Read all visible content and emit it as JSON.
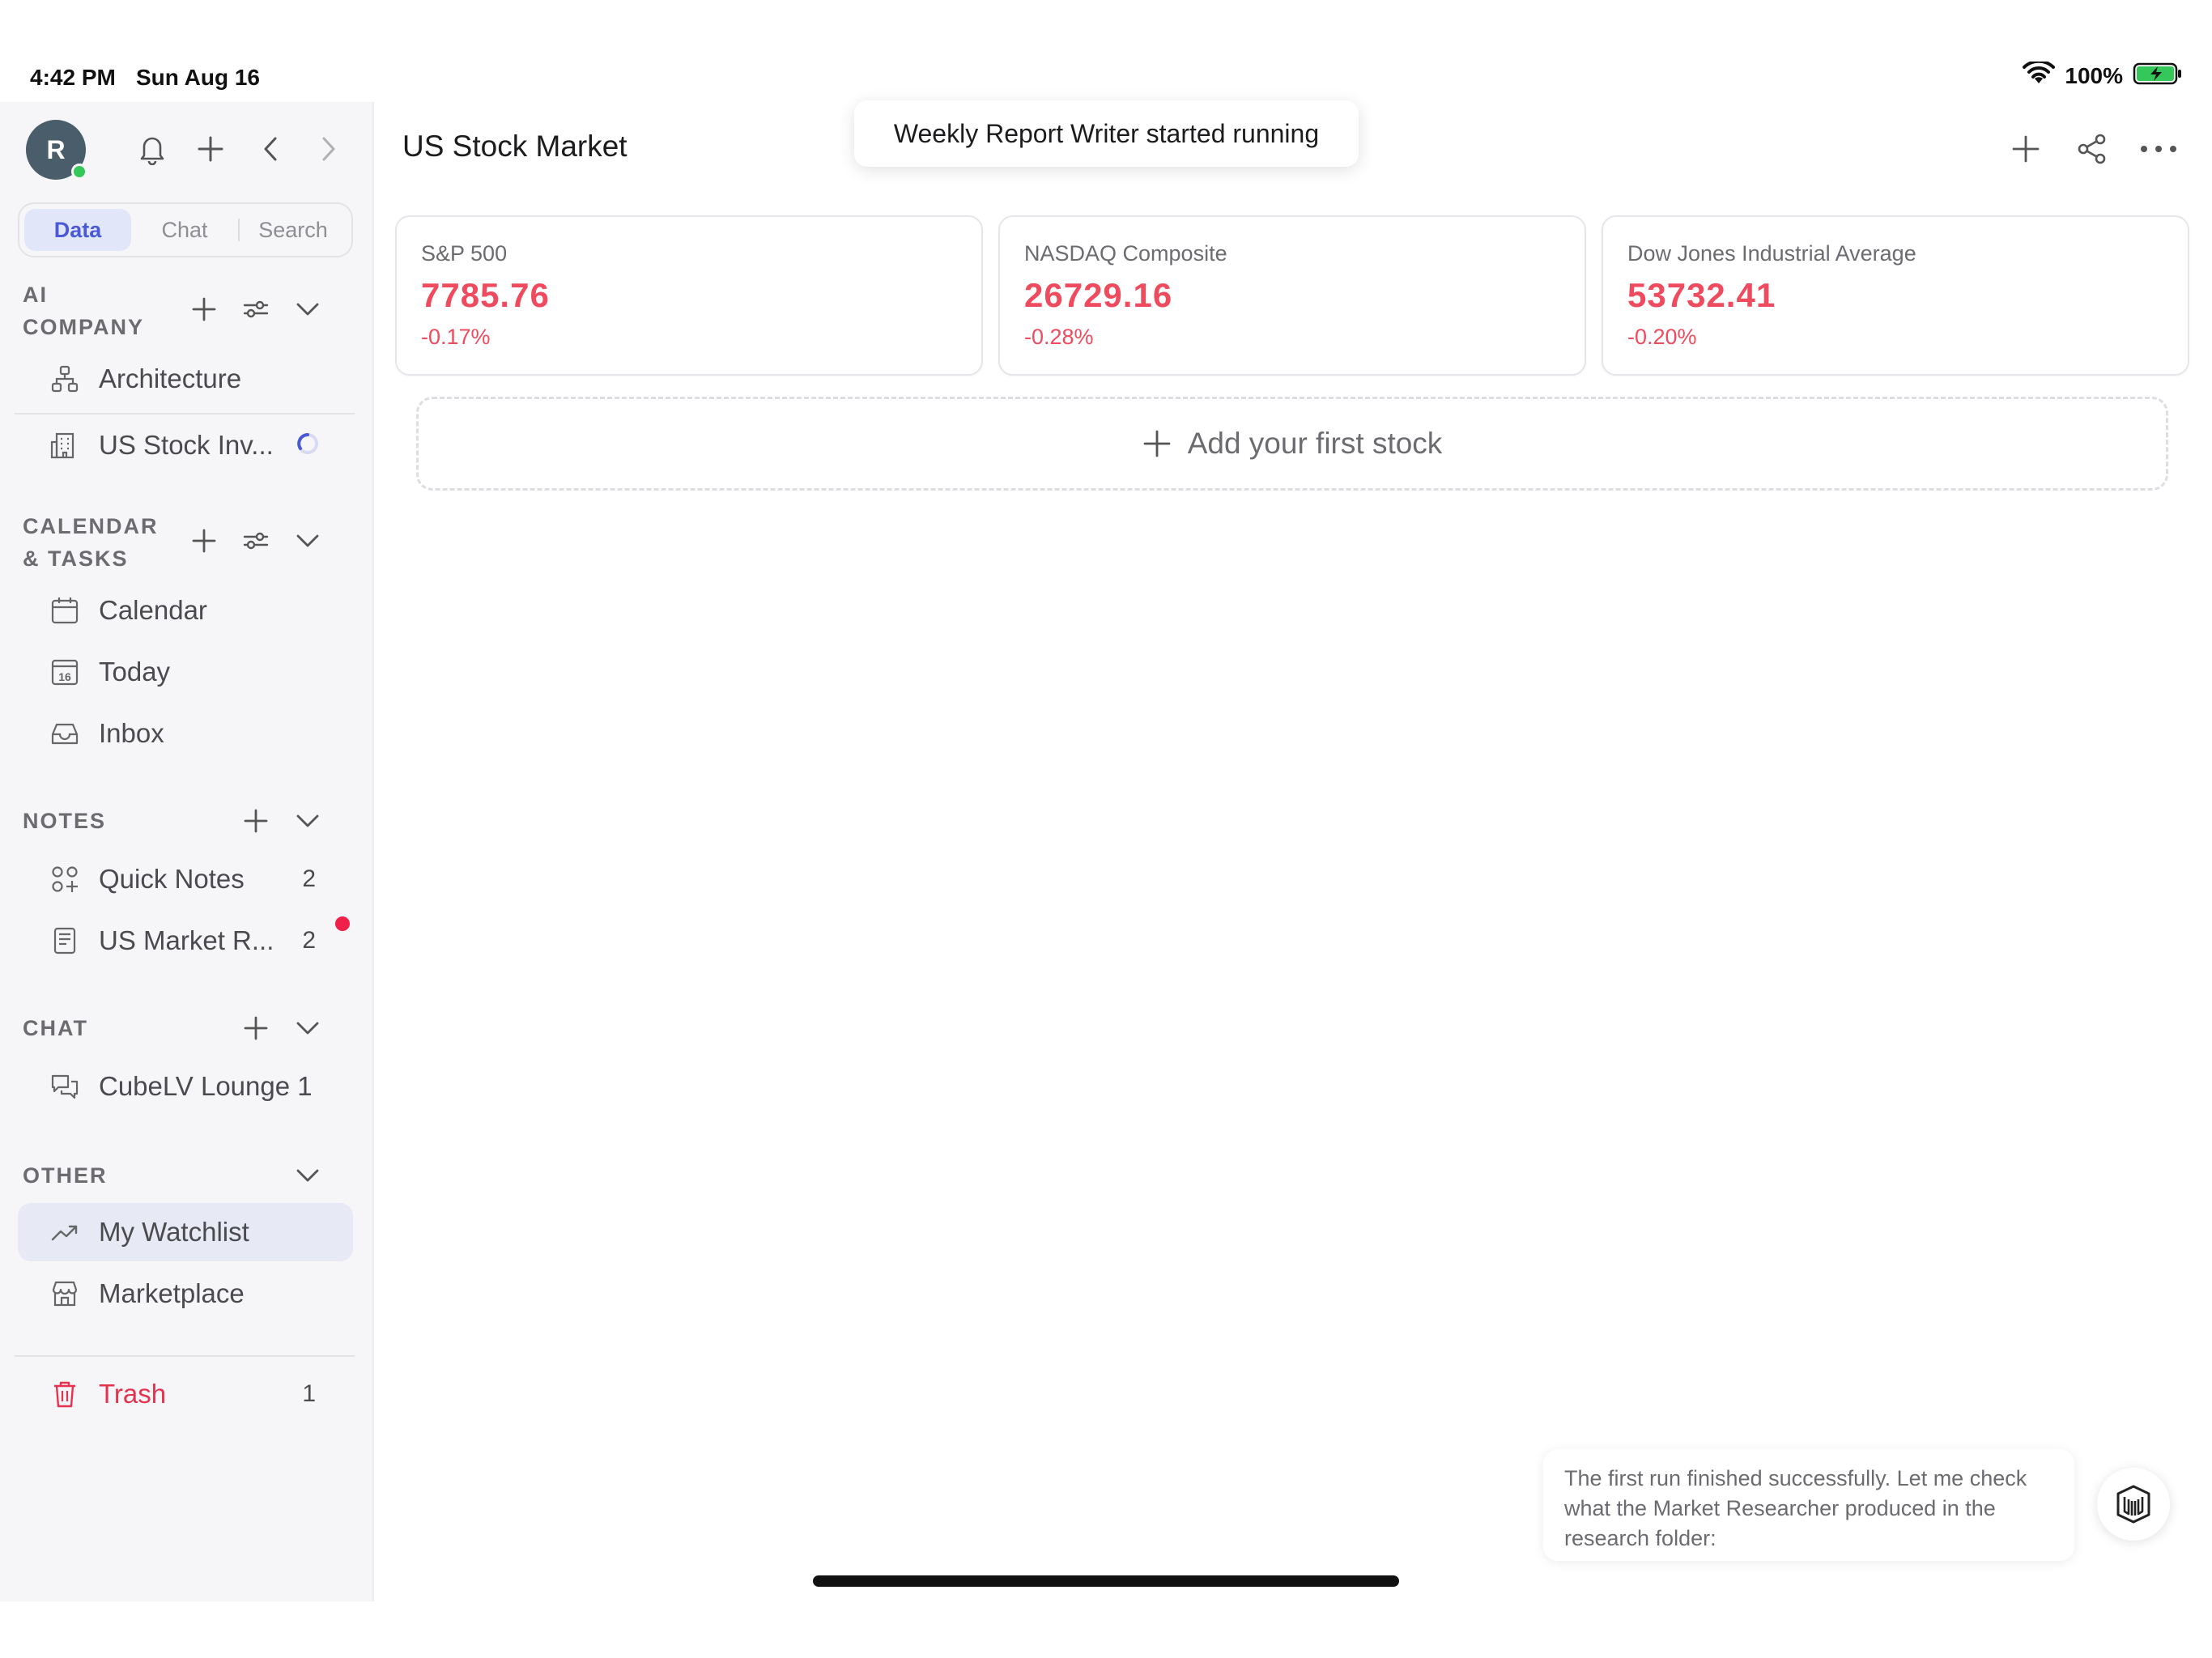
{
  "status_bar": {
    "time": "4:42 PM",
    "date": "Sun Aug 16",
    "battery": "100%"
  },
  "sidebar": {
    "avatar_initial": "R",
    "tabs": [
      {
        "label": "Data",
        "active": true
      },
      {
        "label": "Chat",
        "active": false
      },
      {
        "label": "Search",
        "active": false
      }
    ],
    "sections": {
      "ai_company": {
        "title_line1": "AI",
        "title_line2": "COMPANY",
        "items": [
          {
            "label": "Architecture",
            "icon": "sitemap-icon"
          },
          {
            "label": "US Stock Inv...",
            "icon": "building-icon",
            "status": "loading-spinner"
          }
        ]
      },
      "calendar_tasks": {
        "title_line1": "CALENDAR",
        "title_line2": "& TASKS",
        "items": [
          {
            "label": "Calendar",
            "icon": "calendar-icon"
          },
          {
            "label": "Today",
            "icon": "calendar-today-icon",
            "icon_text": "16"
          },
          {
            "label": "Inbox",
            "icon": "inbox-icon"
          }
        ]
      },
      "notes": {
        "title": "NOTES",
        "items": [
          {
            "label": "Quick Notes",
            "icon": "quick-notes-icon",
            "count": "2"
          },
          {
            "label": "US Market R...",
            "icon": "document-icon",
            "count": "2",
            "unread_dot": true
          }
        ]
      },
      "chat": {
        "title": "CHAT",
        "items": [
          {
            "label": "CubeLV Lounge 1",
            "icon": "chat-bubbles-icon"
          }
        ]
      },
      "other": {
        "title": "OTHER",
        "items": [
          {
            "label": "My Watchlist",
            "icon": "trend-up-icon",
            "active": true
          },
          {
            "label": "Marketplace",
            "icon": "store-icon"
          }
        ]
      }
    },
    "trash": {
      "label": "Trash",
      "count": "1"
    }
  },
  "main": {
    "title": "US Stock Market",
    "toast": "Weekly Report Writer started running",
    "cards": [
      {
        "name": "S&P 500",
        "value": "7785.76",
        "change": "-0.17%"
      },
      {
        "name": "NASDAQ Composite",
        "value": "26729.16",
        "change": "-0.28%"
      },
      {
        "name": "Dow Jones Industrial Average",
        "value": "53732.41",
        "change": "-0.20%"
      }
    ],
    "add_stock_label": "Add your first stock"
  },
  "assistant": {
    "message": "The first run finished successfully. Let me check what the Market Researcher produced in the research folder:"
  },
  "colors": {
    "accent": "#4a5ad6",
    "negative": "#ee4b5f",
    "online": "#34c759",
    "trash": "#e5334f",
    "unread": "#f0204a"
  }
}
